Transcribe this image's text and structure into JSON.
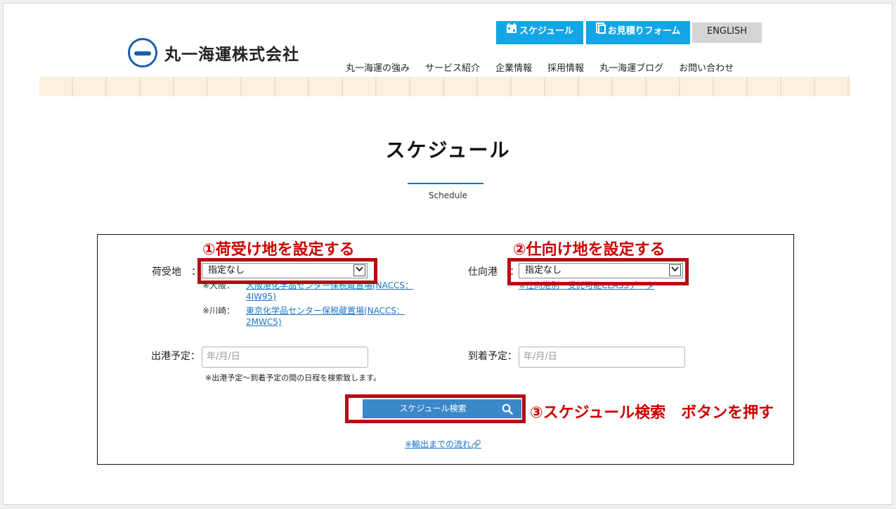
{
  "header": {
    "logo_text": "丸一海運株式会社",
    "schedule_button": "スケジュール",
    "quote_button": "お見積りフォーム",
    "english_button": "ENGLISH",
    "nav": [
      "丸一海運の強み",
      "サービス紹介",
      "企業情報",
      "採用情報",
      "丸一海運ブログ",
      "お問い合わせ"
    ]
  },
  "page": {
    "title": "スケジュール",
    "subtitle": "Schedule"
  },
  "form": {
    "origin_label": "荷受地",
    "origin_colon": "：",
    "origin_value": "指定なし",
    "origin_notes": [
      {
        "city": "※大阪：",
        "link": "大阪港化学品センター保税蔵置場(NACCS：4IW95)"
      },
      {
        "city": "※川崎：",
        "link": "東京化学品センター保税蔵置場(NACCS：2MWC5)"
      }
    ],
    "destination_label": "仕向港",
    "destination_colon": "：",
    "destination_value": "指定なし",
    "destination_note": "※仕向港別　受託可能CLASSデータ",
    "departure_label": "出港予定：",
    "departure_placeholder": "年/月/日",
    "arrival_label": "到着予定：",
    "arrival_placeholder": "年/月/日",
    "date_hint": "※出港予定〜到着予定の間の日程を検索致します。",
    "search_button": "スケジュール検索",
    "flow_link": "※輸出までの流れ🔗"
  },
  "annotations": {
    "step1": "①荷受け地を設定する",
    "step2": "②仕向け地を設定する",
    "step3": "③スケジュール検索　ボタンを押す"
  },
  "colors": {
    "accent_blue": "#12a6e6",
    "button_blue": "#3b88c9",
    "annotation_red": "#cc0000",
    "box_red": "#b50d12"
  },
  "icons": {
    "schedule": "calendar-icon",
    "quote": "document-icon",
    "search": "search-icon",
    "select": "chevron-down-icon",
    "logo": "logo-mark-icon"
  }
}
